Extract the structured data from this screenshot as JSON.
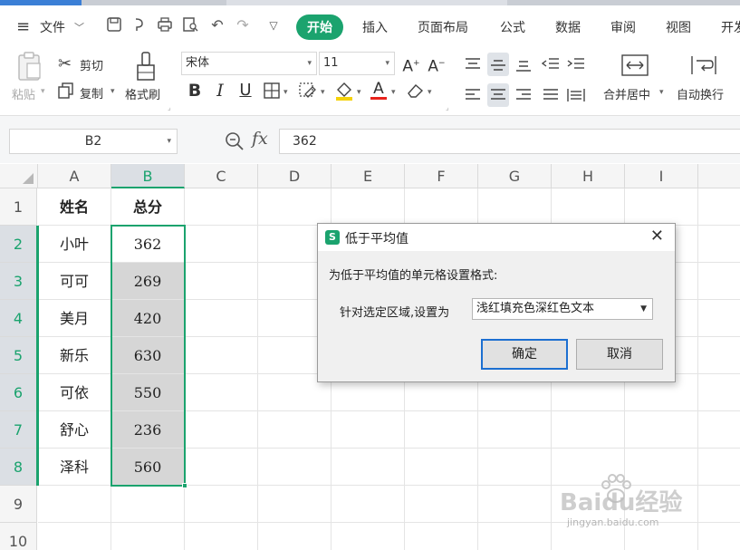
{
  "menu": {
    "file": "文件",
    "tabs": [
      "开始",
      "插入",
      "页面布局",
      "公式",
      "数据",
      "审阅",
      "视图",
      "开发"
    ]
  },
  "ribbon": {
    "paste": "粘贴",
    "cut": "剪切",
    "copy": "复制",
    "format_painter": "格式刷",
    "font_name": "宋体",
    "font_size": "11",
    "merge_center": "合并居中",
    "wrap_text": "自动换行"
  },
  "formula_bar": {
    "name_box": "B2",
    "fx_label": "fx",
    "value": "362"
  },
  "sheet": {
    "columns": [
      "A",
      "B",
      "C",
      "D",
      "E",
      "F",
      "G",
      "H",
      "I"
    ],
    "rows": [
      "1",
      "2",
      "3",
      "4",
      "5",
      "6",
      "7",
      "8",
      "9",
      "10"
    ],
    "headers": [
      "姓名",
      "总分"
    ],
    "records": [
      [
        "小叶",
        "362"
      ],
      [
        "可可",
        "269"
      ],
      [
        "美月",
        "420"
      ],
      [
        "新乐",
        "630"
      ],
      [
        "可依",
        "550"
      ],
      [
        "舒心",
        "236"
      ],
      [
        "泽科",
        "560"
      ]
    ]
  },
  "dialog": {
    "logo": "S",
    "title": "低于平均值",
    "message": "为低于平均值的单元格设置格式:",
    "label": "针对选定区域,设置为",
    "option": "浅红填充色深红色文本",
    "ok": "确定",
    "cancel": "取消"
  },
  "watermark": {
    "brand": "Baidu经验",
    "url": "jingyan.baidu.com"
  },
  "colors": {
    "accent": "#1ba36e",
    "selection_fill": "#d6d6d6",
    "dialog_focus": "#1c6fd1"
  }
}
